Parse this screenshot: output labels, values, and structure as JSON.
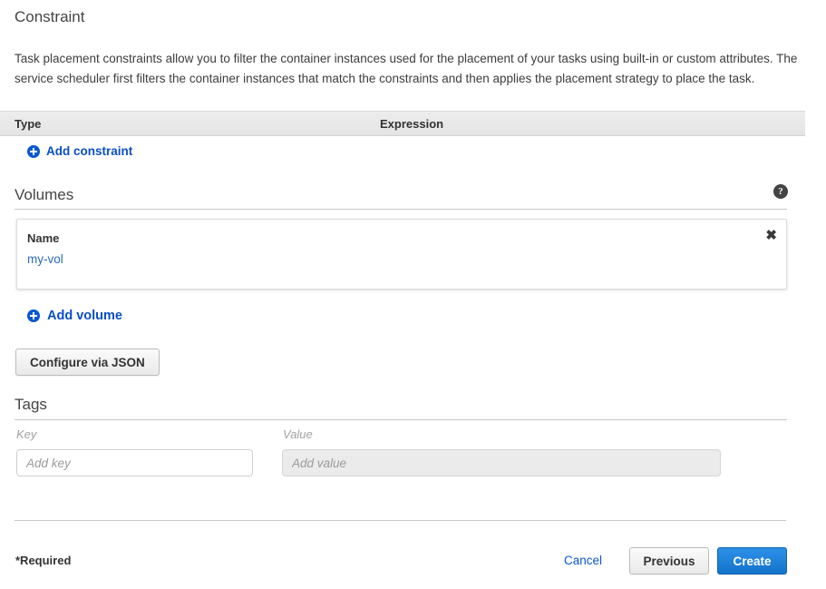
{
  "constraint": {
    "title": "Constraint",
    "description": "Task placement constraints allow you to filter the container instances used for the placement of your tasks using built-in or custom attributes. The service scheduler first filters the container instances that match the constraints and then applies the placement strategy to place the task.",
    "table": {
      "columns": [
        "Type",
        "Expression"
      ],
      "rows": []
    },
    "add_label": "Add constraint",
    "add_icon": "plus-circle-icon"
  },
  "volumes": {
    "title": "Volumes",
    "help_icon": "help-circle-icon",
    "help_glyph": "?",
    "items": [
      {
        "name_label": "Name",
        "name_value": "my-vol",
        "remove_icon": "close-icon",
        "remove_glyph": "✖"
      }
    ],
    "add_label": "Add volume",
    "add_icon": "plus-circle-icon",
    "configure_json_label": "Configure via JSON"
  },
  "tags": {
    "title": "Tags",
    "key_label": "Key",
    "value_label": "Value",
    "key_value": "",
    "value_value": "",
    "key_placeholder": "Add key",
    "value_placeholder": "Add value"
  },
  "footer": {
    "required_note": "*Required",
    "cancel_label": "Cancel",
    "previous_label": "Previous",
    "create_label": "Create"
  },
  "colors": {
    "link_blue": "#0a57d0",
    "value_link_blue": "#2b6cb7",
    "primary_button_blue": "#1474cc",
    "table_header_gray": "#e9e9e9",
    "disabled_input_gray": "#ebebeb"
  }
}
